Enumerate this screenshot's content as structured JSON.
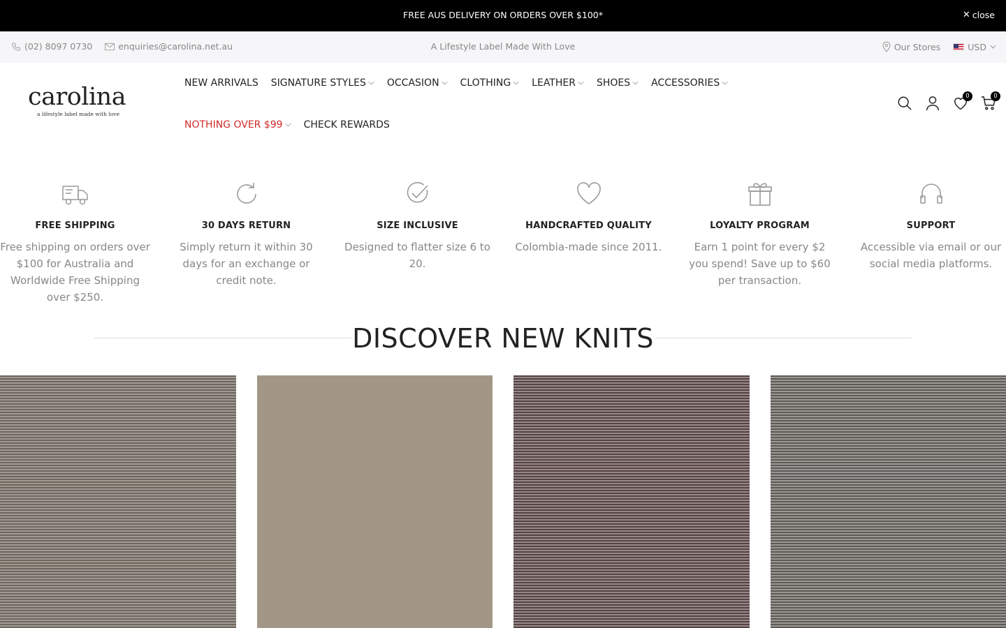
{
  "announcement": {
    "text": "FREE AUS DELIVERY ON ORDERS OVER $100*",
    "close_label": "close"
  },
  "topbar": {
    "phone": "(02) 8097 0730",
    "email": "enquiries@carolina.net.au",
    "tagline": "A Lifestyle Label Made With Love",
    "stores_label": "Our Stores",
    "currency": "USD"
  },
  "header": {
    "logo_word": "carolina",
    "logo_tagline": "a lifestyle label made with love",
    "nav_row1": [
      {
        "label": "NEW ARRIVALS"
      },
      {
        "label": "SIGNATURE STYLES"
      },
      {
        "label": "OCCASION"
      },
      {
        "label": "CLOTHING"
      },
      {
        "label": "LEATHER"
      },
      {
        "label": "SHOES"
      },
      {
        "label": "ACCESSORIES"
      }
    ],
    "nav_row2": [
      {
        "label": "NOTHING OVER $99"
      },
      {
        "label": "CHECK REWARDS"
      }
    ],
    "wishlist_count": "0",
    "cart_count": "0"
  },
  "features": [
    {
      "icon": "truck-icon",
      "title": "FREE SHIPPING",
      "desc": "Free shipping on orders over $100 for Australia and Worldwide Free Shipping over $250."
    },
    {
      "icon": "refresh-icon",
      "title": "30 DAYS RETURN",
      "desc": "Simply return it within 30 days for an exchange or credit note."
    },
    {
      "icon": "check-circle-icon",
      "title": "SIZE INCLUSIVE",
      "desc": "Designed to flatter size 6 to 20."
    },
    {
      "icon": "heart-icon",
      "title": "HANDCRAFTED QUALITY",
      "desc": "Colombia-made since 2011."
    },
    {
      "icon": "gift-icon",
      "title": "LOYALTY PROGRAM",
      "desc": "Earn 1 point for every $2 you spend! Save up to $60 per transaction."
    },
    {
      "icon": "headphones-icon",
      "title": "SUPPORT",
      "desc": "Accessible via email or our social media platforms."
    }
  ],
  "section": {
    "title": "DISCOVER NEW KNITS"
  },
  "colors": {
    "announcement_bg": "#000000",
    "topbar_bg": "#f6f6f8",
    "sale_red": "#d02b2b",
    "muted_text": "#878787"
  }
}
